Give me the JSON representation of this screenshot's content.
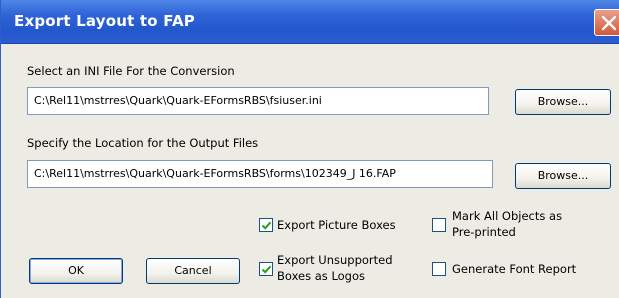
{
  "window": {
    "title": "Export Layout to FAP"
  },
  "ini_section": {
    "label": "Select an INI File For the Conversion",
    "path_value": "C:\\Rel11\\mstrres\\Quark\\Quark-EFormsRBS\\fsiuser.ini",
    "browse_label": "Browse..."
  },
  "output_section": {
    "label": "Specify the Location for the Output Files",
    "path_value": "C:\\Rel11\\mstrres\\Quark\\Quark-EFormsRBS\\forms\\102349_J 16.FAP",
    "browse_label": "Browse..."
  },
  "options": {
    "export_picture_boxes": {
      "line1": "Export Picture Boxes",
      "checked": true
    },
    "export_unsupported": {
      "line1": "Export Unsupported",
      "line2": "Boxes as Logos",
      "checked": true
    },
    "mark_preprinted": {
      "line1": "Mark All Objects as",
      "line2": "Pre-printed",
      "checked": false
    },
    "font_report": {
      "line1": "Generate Font Report",
      "checked": false
    }
  },
  "buttons": {
    "ok_label": "OK",
    "cancel_label": "Cancel"
  }
}
